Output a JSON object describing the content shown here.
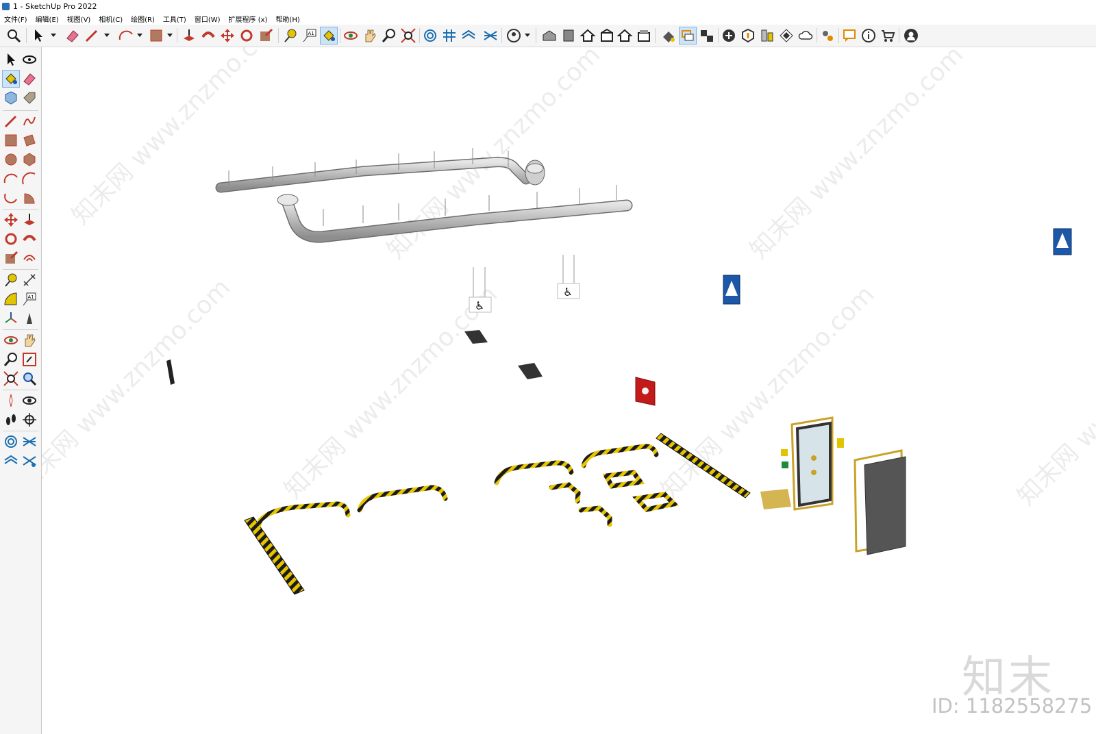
{
  "window": {
    "title": "1 - SketchUp Pro 2022"
  },
  "menu": [
    "文件(F)",
    "编辑(E)",
    "视图(V)",
    "相机(C)",
    "绘图(R)",
    "工具(T)",
    "窗口(W)",
    "扩展程序 (x)",
    "帮助(H)"
  ],
  "toolbar_icons": [
    "zoom-icon",
    "select-icon",
    "eraser-icon",
    "pencil-icon",
    "arc-icon",
    "rectangle-icon",
    "push-pull-icon",
    "follow-me-icon",
    "move-icon",
    "rotate-icon",
    "scale-icon",
    "tape-measure-icon",
    "text-icon",
    "paint-bucket-icon",
    "orbit-icon",
    "pan-icon",
    "zoom-window-icon",
    "zoom-extents-icon",
    "sandbox-from-contours-icon",
    "sandbox-from-scratch-icon",
    "sandbox-smoove-icon",
    "sandbox-stamp-icon",
    "account-icon",
    "views-iso-icon",
    "views-top-icon",
    "views-front-icon",
    "views-right-icon",
    "views-back-icon",
    "views-left-icon",
    "styles-icon",
    "section-plane-icon",
    "section-display-icon",
    "solid-tools-icon",
    "outer-shell-icon",
    "components-icon",
    "materials-icon",
    "cloud-icon",
    "extension-manager-icon",
    "message-icon",
    "info-icon",
    "cart-icon",
    "user-icon"
  ],
  "left_tools": [
    [
      "select-icon",
      "orbit-icon"
    ],
    [
      "paint-bucket-icon",
      "eraser-icon"
    ],
    [
      "make-component-icon",
      "tag-icon"
    ],
    [
      "pencil-icon",
      "freehand-icon"
    ],
    [
      "rectangle-icon",
      "rotated-rectangle-icon"
    ],
    [
      "circle-icon",
      "polygon-icon"
    ],
    [
      "arc-icon",
      "two-point-arc-icon"
    ],
    [
      "three-point-arc-icon",
      "pie-icon"
    ],
    [
      "move-icon",
      "push-pull-icon"
    ],
    [
      "rotate-icon",
      "follow-me-icon"
    ],
    [
      "scale-icon",
      "offset-icon"
    ],
    [
      "tape-measure-icon",
      "dimension-icon"
    ],
    [
      "protractor-icon",
      "text-icon"
    ],
    [
      "axes-icon",
      "3d-text-icon"
    ],
    [
      "orbit-icon",
      "pan-icon"
    ],
    [
      "zoom-icon",
      "zoom-window-icon"
    ],
    [
      "zoom-extents-icon",
      "previous-view-icon"
    ],
    [
      "position-camera-icon",
      "look-around-icon"
    ],
    [
      "walk-icon",
      "section-plane-icon"
    ],
    [
      "sandbox-from-contours-icon",
      "sandbox-from-scratch-icon"
    ],
    [
      "sandbox-smoove-icon",
      "sandbox-stamp-icon"
    ]
  ],
  "colors": {
    "hazard_yellow": "#e6c400",
    "hazard_black": "#1b1b1b",
    "duct_gray": "#c4c4c4",
    "sign_blue": "#1c57a8",
    "fire_red": "#c41a1a",
    "door_gold": "#c9a227"
  },
  "watermarks": {
    "logo": "知末",
    "id": "ID: 1182558275",
    "repeat": "知末网 www.znzmo.com"
  }
}
